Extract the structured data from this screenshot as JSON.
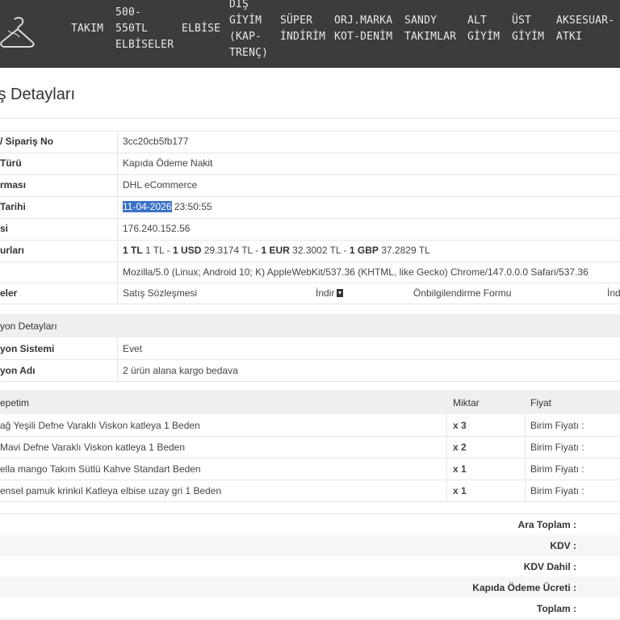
{
  "nav": {
    "items": [
      {
        "lines": [
          "TAKIM"
        ]
      },
      {
        "lines": [
          "500-",
          "550TL",
          "ELBİSELER"
        ]
      },
      {
        "lines": [
          "ELBİSE"
        ]
      },
      {
        "lines": [
          "DIŞ",
          "GİYİM",
          "(KAP-",
          "TRENÇ)"
        ]
      },
      {
        "lines": [
          "SÜPER",
          "İNDİRİM"
        ]
      },
      {
        "lines": [
          "ORJ.MARKA",
          "KOT-DENİM"
        ]
      },
      {
        "lines": [
          "SANDY",
          "TAKIMLAR"
        ]
      },
      {
        "lines": [
          "ALT",
          "GİYİM"
        ]
      },
      {
        "lines": [
          "ÜST",
          "GİYİM"
        ]
      },
      {
        "lines": [
          "AKSESUAR-",
          "ATKI"
        ]
      }
    ]
  },
  "page": {
    "title": "iş Detayları"
  },
  "order": {
    "rows": [
      {
        "label": "/ Sipariş No",
        "value": "3cc20cb5fb177"
      },
      {
        "label": "Türü",
        "value": "Kapıda Ödeme Nakit"
      },
      {
        "label": "rması",
        "value": "DHL eCommerce"
      },
      {
        "label": "Tarihi",
        "date": "11-04-2026",
        "time": "23:50:55"
      },
      {
        "label": "si",
        "value": "176.240.152.56"
      },
      {
        "label": "urları",
        "rates": {
          "p1_b": "1 TL",
          "p1": "1 TL -",
          "p2_b": "1 USD",
          "p2": "29.3174 TL -",
          "p3_b": "1 EUR",
          "p3": "32.3002 TL -",
          "p4_b": "1 GBP",
          "p4": "37.2829 TL"
        }
      },
      {
        "label": "",
        "value": "Mozilla/5.0 (Linux; Android 10; K) AppleWebKit/537.36 (KHTML, like Gecko) Chrome/147.0.0.0 Safari/537.36"
      },
      {
        "label": "eler",
        "doc1": "Satış Sözleşmesi",
        "download": "İndir",
        "doc2": "Önbilgilendirme Formu",
        "download2": "İnd"
      }
    ]
  },
  "campaign": {
    "heading": "yon Detayları",
    "rows": [
      {
        "label": "yon Sistemi",
        "value": "Evet"
      },
      {
        "label": "yon Adı",
        "value": "2 ürün alana kargo bedava"
      }
    ]
  },
  "cart": {
    "col_product": "epetim",
    "col_qty": "Miktar",
    "col_price": "Fiyat",
    "items": [
      {
        "name": "ağ Yeşili Defne Varaklı Viskon katleya 1 Beden",
        "qty": "x 3",
        "price": "Birim Fiyatı :"
      },
      {
        "name": "Mavi Defne Varaklı Viskon katleya 1 Beden",
        "qty": "x 2",
        "price": "Birim Fiyatı :"
      },
      {
        "name": "ella mango Takım Sütlü Kahve Standart Beden",
        "qty": "x 1",
        "price": "Birim Fiyatı :"
      },
      {
        "name": "ensel pamuk krinkıl Katleya elbise uzay gri 1 Beden",
        "qty": "x 1",
        "price": "Birim Fiyatı :"
      }
    ]
  },
  "totals": {
    "subtotal": "Ara Toplam :",
    "vat": "KDV :",
    "vat_incl": "KDV Dahil :",
    "cod_fee": "Kapıda Ödeme Ücreti :",
    "total": "Toplam :"
  }
}
